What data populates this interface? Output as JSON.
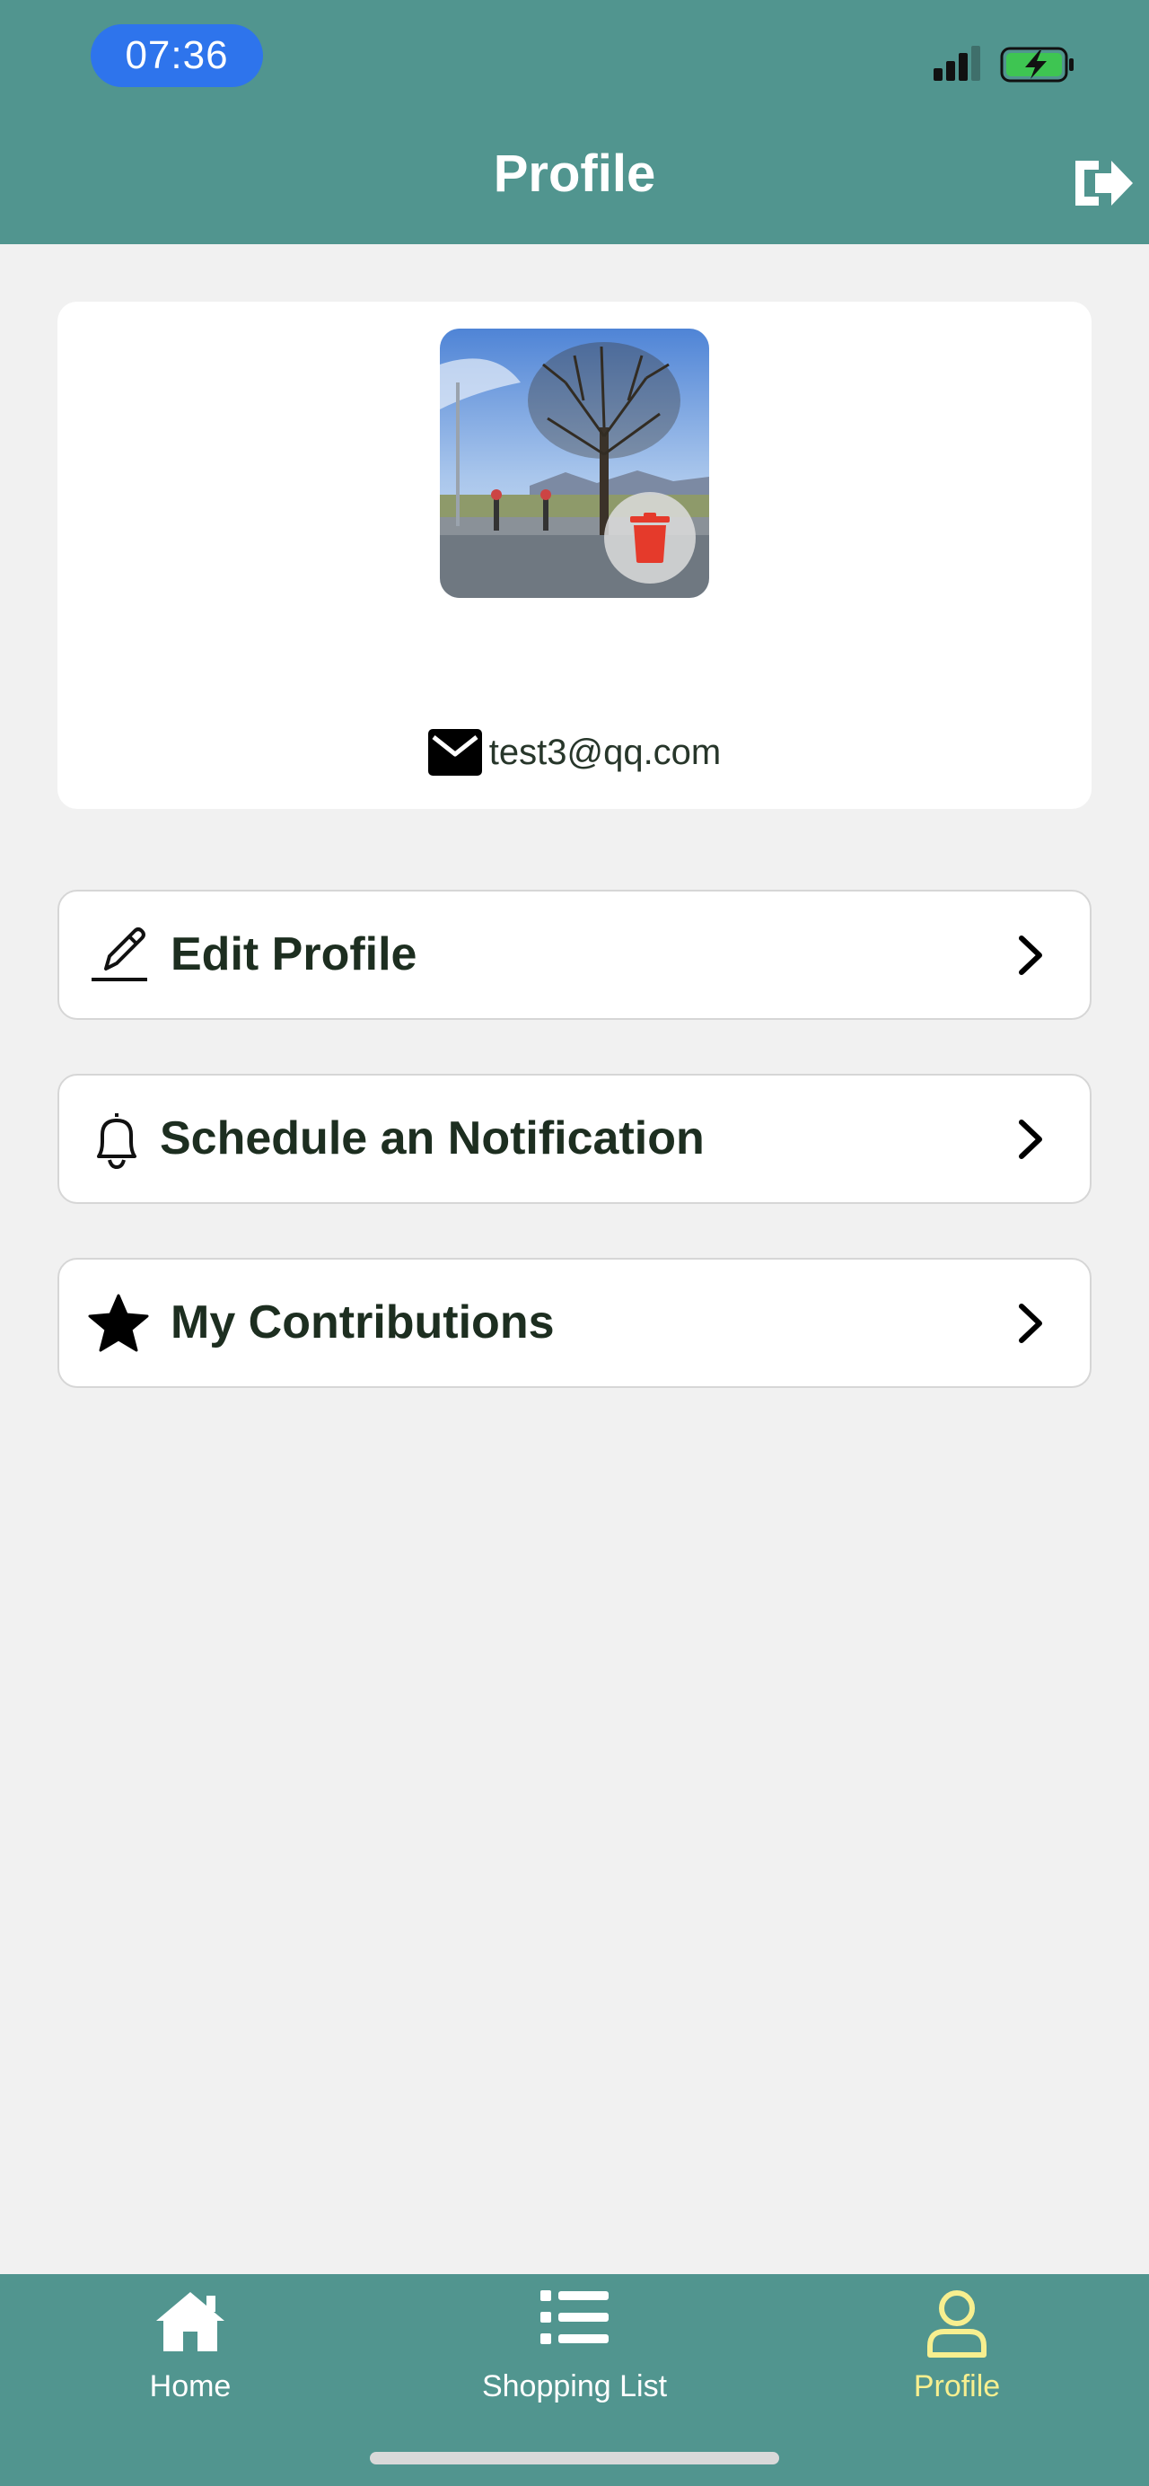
{
  "status_bar": {
    "time": "07:36"
  },
  "header": {
    "title": "Profile",
    "logout_icon": "logout-icon"
  },
  "profile": {
    "email": "test3@qq.com",
    "avatar_alt": "profile photo",
    "delete_icon": "trash-icon"
  },
  "menu": [
    {
      "label": "Edit Profile",
      "icon": "pencil-icon"
    },
    {
      "label": "Schedule an Notification",
      "icon": "bell-icon"
    },
    {
      "label": "My Contributions",
      "icon": "star-icon"
    }
  ],
  "tabs": [
    {
      "label": "Home",
      "icon": "home-icon",
      "active": false
    },
    {
      "label": "Shopping List",
      "icon": "list-icon",
      "active": false
    },
    {
      "label": "Profile",
      "icon": "user-icon",
      "active": true
    }
  ],
  "colors": {
    "header": "#51958f",
    "active_tab": "#f7ef8f",
    "time_pill": "#2e74ec",
    "delete": "#e53a2b"
  }
}
